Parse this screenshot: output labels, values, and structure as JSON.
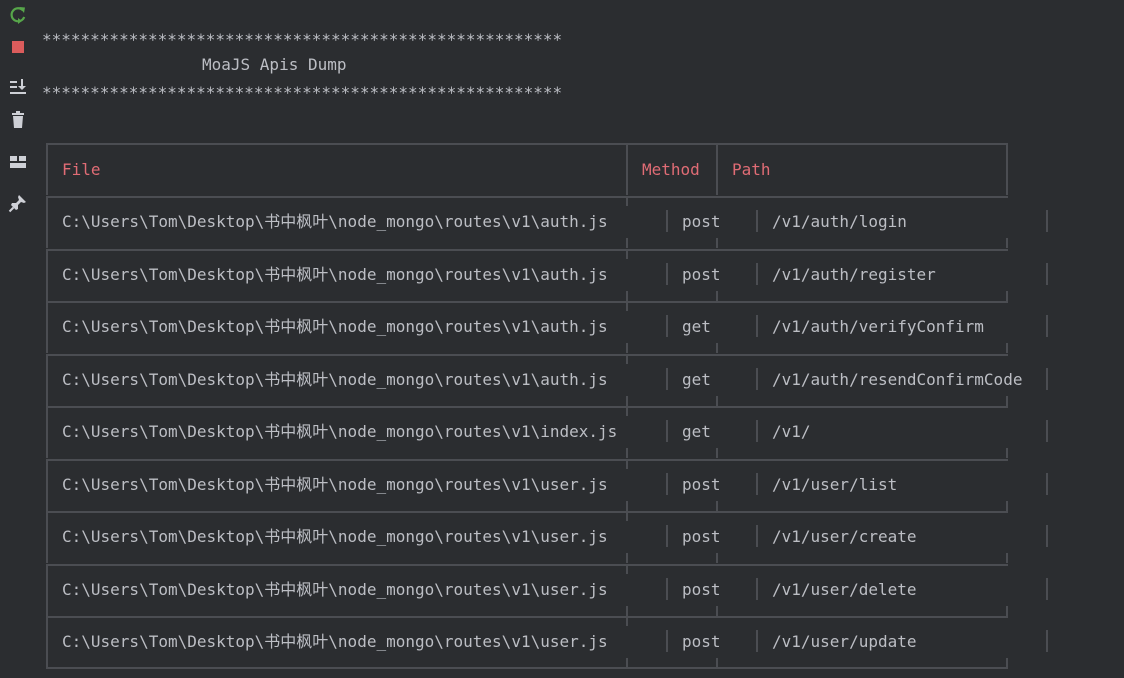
{
  "toolbar": {
    "rerun_icon": "rerun-icon",
    "stop_icon": "stop-icon",
    "scroll_end_icon": "scroll-to-end-icon",
    "clear_icon": "trash-icon",
    "layout_icon": "layout-icon",
    "pin_icon": "pin-icon"
  },
  "console": {
    "banner_top": "******************************************************",
    "banner_title": "MoaJS Apis Dump",
    "banner_bottom": "******************************************************",
    "headers": {
      "file": "File",
      "method": "Method",
      "path": "Path"
    },
    "rows": [
      {
        "file": "C:\\Users\\Tom\\Desktop\\书中枫叶\\node_mongo\\routes\\v1\\auth.js",
        "method": "post",
        "path": "/v1/auth/login"
      },
      {
        "file": "C:\\Users\\Tom\\Desktop\\书中枫叶\\node_mongo\\routes\\v1\\auth.js",
        "method": "post",
        "path": "/v1/auth/register"
      },
      {
        "file": "C:\\Users\\Tom\\Desktop\\书中枫叶\\node_mongo\\routes\\v1\\auth.js",
        "method": "get",
        "path": "/v1/auth/verifyConfirm"
      },
      {
        "file": "C:\\Users\\Tom\\Desktop\\书中枫叶\\node_mongo\\routes\\v1\\auth.js",
        "method": "get",
        "path": "/v1/auth/resendConfirmCode"
      },
      {
        "file": "C:\\Users\\Tom\\Desktop\\书中枫叶\\node_mongo\\routes\\v1\\index.js",
        "method": "get",
        "path": "/v1/"
      },
      {
        "file": "C:\\Users\\Tom\\Desktop\\书中枫叶\\node_mongo\\routes\\v1\\user.js",
        "method": "post",
        "path": "/v1/user/list"
      },
      {
        "file": "C:\\Users\\Tom\\Desktop\\书中枫叶\\node_mongo\\routes\\v1\\user.js",
        "method": "post",
        "path": "/v1/user/create"
      },
      {
        "file": "C:\\Users\\Tom\\Desktop\\书中枫叶\\node_mongo\\routes\\v1\\user.js",
        "method": "post",
        "path": "/v1/user/delete"
      },
      {
        "file": "C:\\Users\\Tom\\Desktop\\书中枫叶\\node_mongo\\routes\\v1\\user.js",
        "method": "post",
        "path": "/v1/user/update"
      }
    ]
  }
}
